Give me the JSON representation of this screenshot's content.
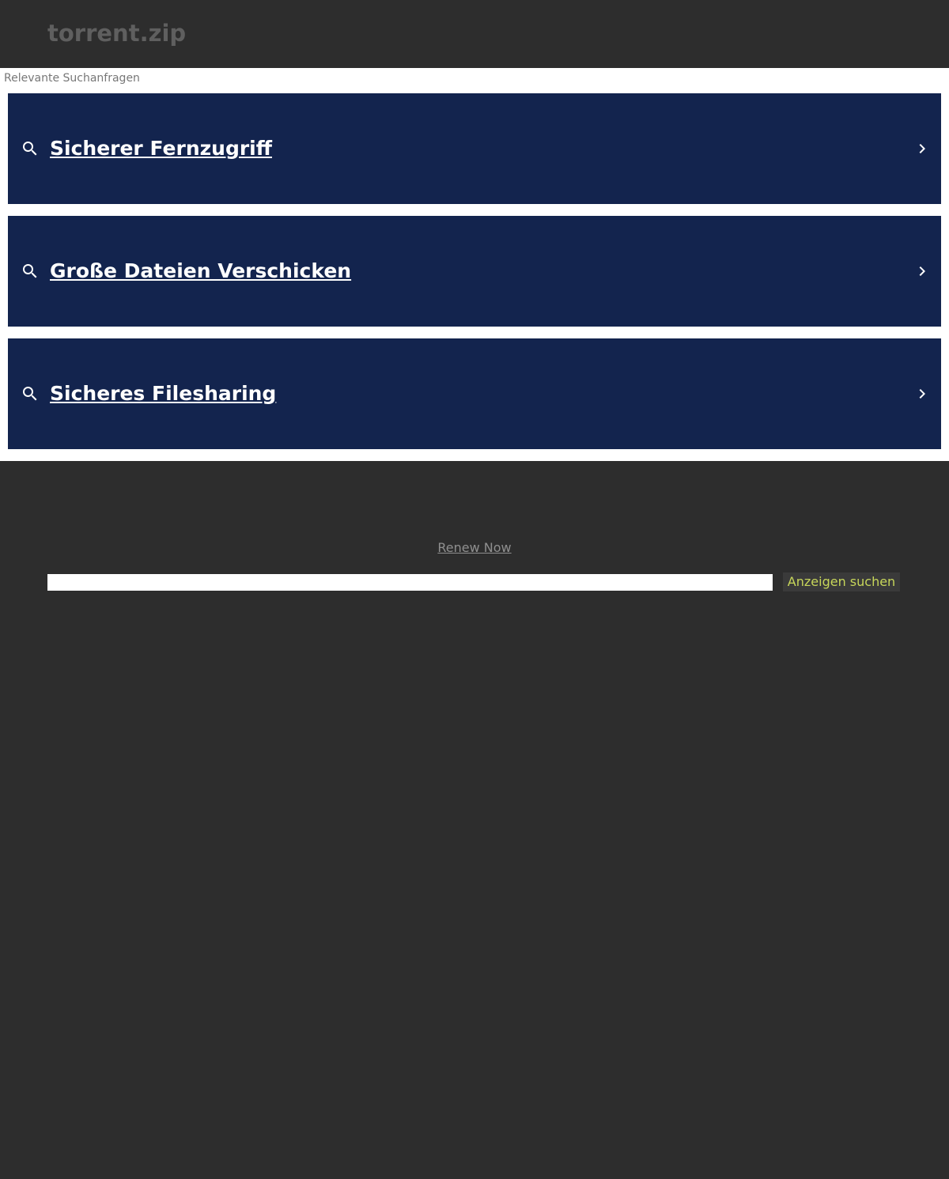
{
  "header": {
    "site_title": "torrent.zip"
  },
  "results": {
    "heading": "Relevante Suchanfragen",
    "items": [
      {
        "label": "Sicherer Fernzugriff",
        "icon": "search-icon",
        "trailing_icon": "chevron-right-icon"
      },
      {
        "label": "Große Dateien Verschicken",
        "icon": "search-icon",
        "trailing_icon": "chevron-right-icon"
      },
      {
        "label": "Sicheres Filesharing",
        "icon": "search-icon",
        "trailing_icon": "chevron-right-icon"
      }
    ]
  },
  "footer": {
    "renew_label": "Renew Now",
    "search_placeholder": "",
    "search_button_label": "Anzeigen suchen"
  },
  "colors": {
    "background": "#2d2d2d",
    "result_bar": "#13244e",
    "search_button_text": "#c7d65a",
    "title_text": "#5f5f5f"
  }
}
